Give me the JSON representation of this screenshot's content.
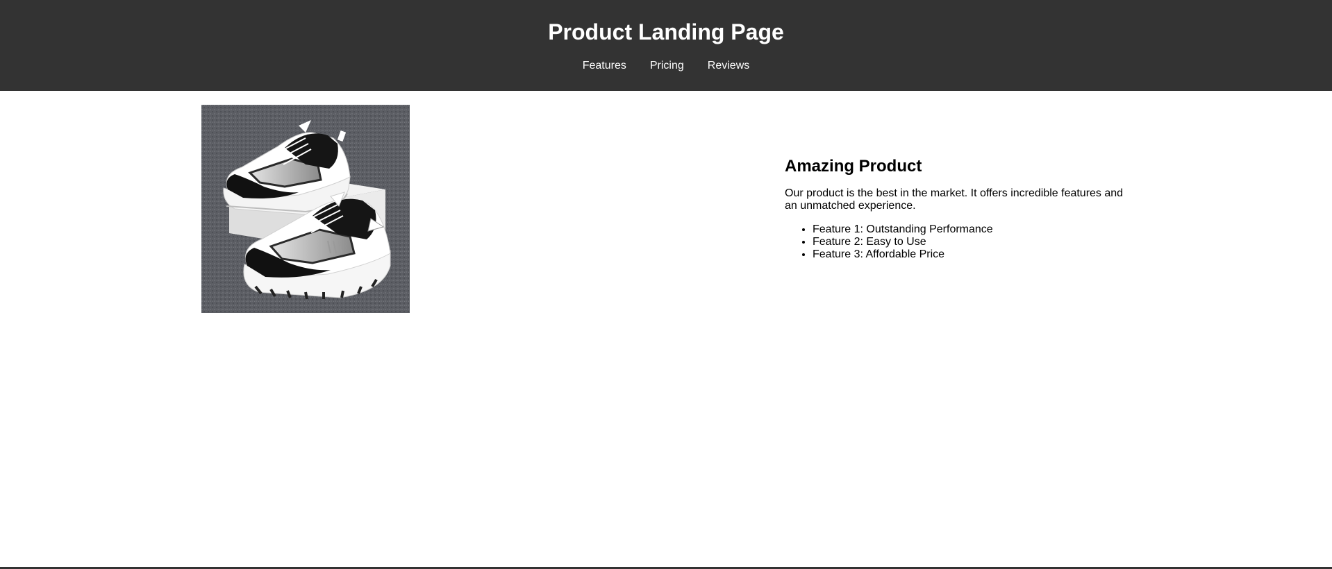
{
  "header": {
    "title": "Product Landing Page",
    "nav": [
      {
        "label": "Features"
      },
      {
        "label": "Pricing"
      },
      {
        "label": "Reviews"
      }
    ]
  },
  "product": {
    "image_icon": "sneakers-image",
    "title": "Amazing Product",
    "description": "Our product is the best in the market. It offers incredible features and an unmatched experience.",
    "features": [
      "Feature 1: Outstanding Performance",
      "Feature 2: Easy to Use",
      "Feature 3: Affordable Price"
    ]
  },
  "colors": {
    "header_background": "#333333",
    "header_text": "#ffffff",
    "page_background": "#ffffff",
    "body_text": "#000000"
  }
}
